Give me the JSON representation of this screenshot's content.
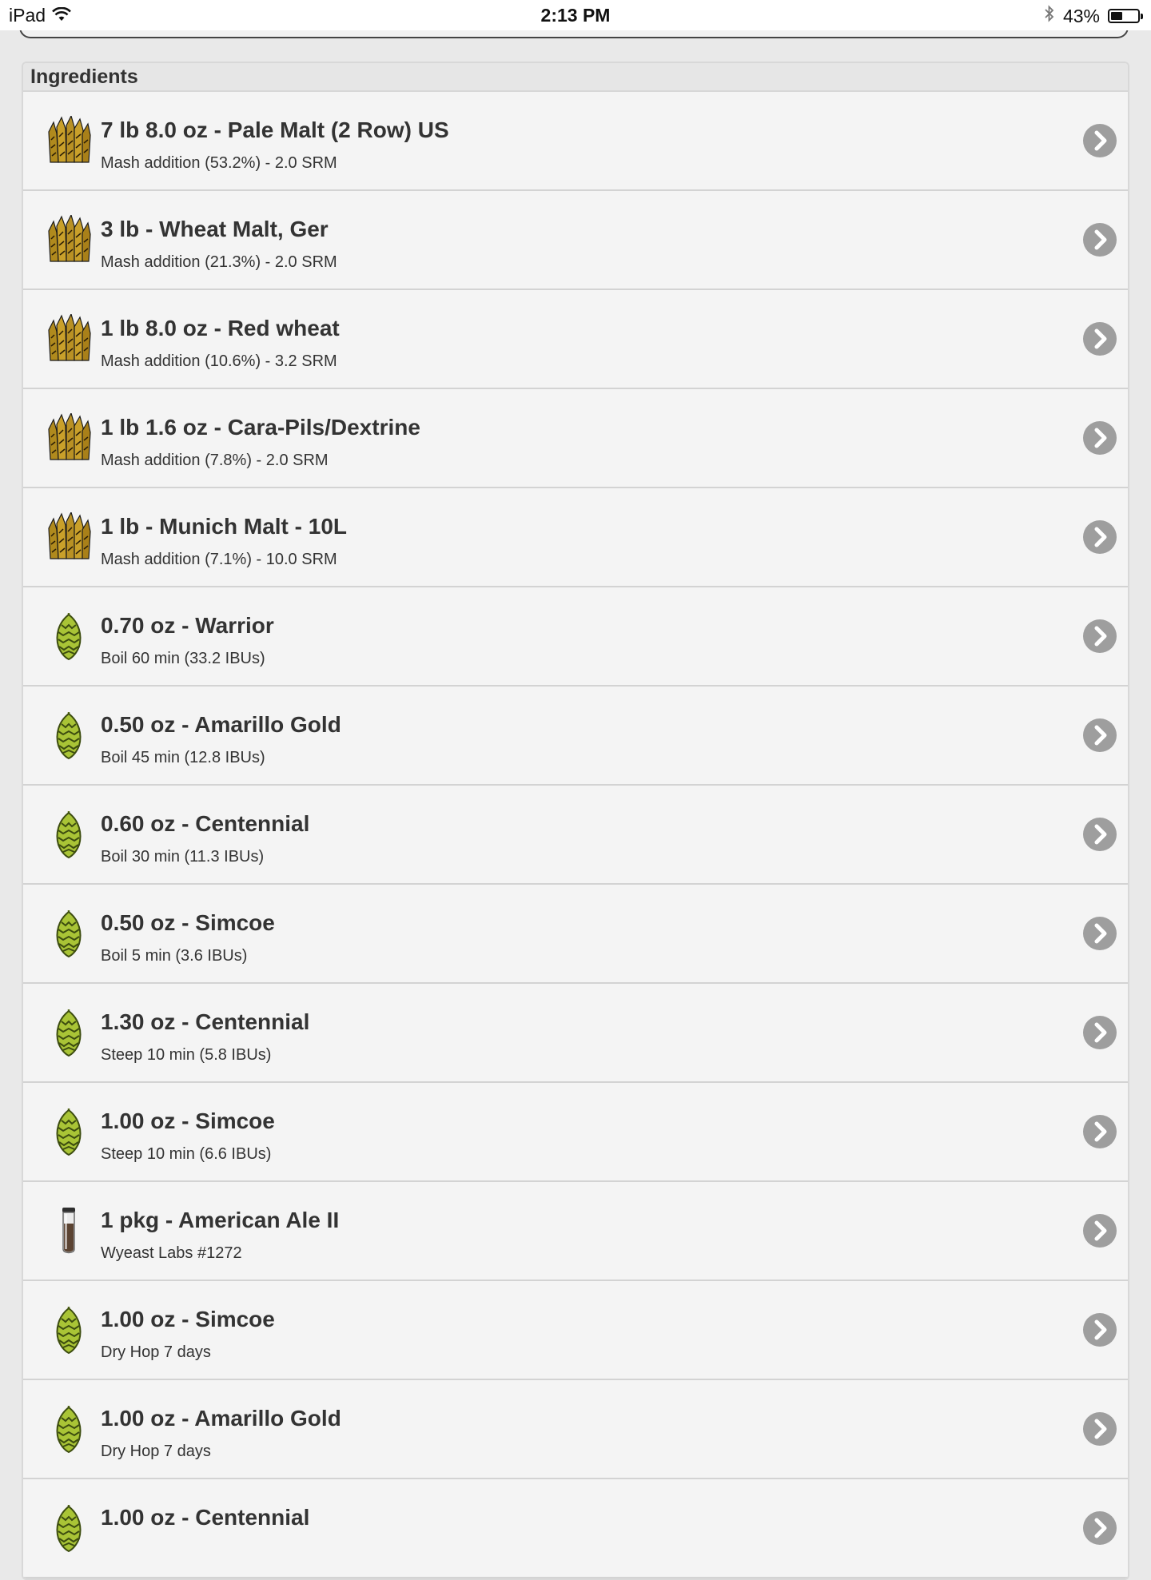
{
  "status_bar": {
    "device": "iPad",
    "time": "2:13 PM",
    "battery": "43%",
    "battery_level": 0.43,
    "icons": [
      "wifi-icon",
      "bluetooth-icon",
      "battery-icon"
    ]
  },
  "section": {
    "title": "Ingredients"
  },
  "ingredients": [
    {
      "type": "grain",
      "title": "7 lb 8.0 oz - Pale Malt (2 Row) US",
      "detail": "Mash addition (53.2%) - 2.0 SRM"
    },
    {
      "type": "grain",
      "title": "3 lb - Wheat Malt, Ger",
      "detail": "Mash addition (21.3%) - 2.0 SRM"
    },
    {
      "type": "grain",
      "title": "1 lb 8.0 oz - Red wheat",
      "detail": "Mash addition (10.6%) - 3.2 SRM"
    },
    {
      "type": "grain",
      "title": "1 lb 1.6 oz - Cara-Pils/Dextrine",
      "detail": "Mash addition (7.8%) - 2.0 SRM"
    },
    {
      "type": "grain",
      "title": "1 lb - Munich Malt - 10L",
      "detail": "Mash addition (7.1%) - 10.0 SRM"
    },
    {
      "type": "hop",
      "title": "0.70 oz - Warrior",
      "detail": "Boil 60 min (33.2 IBUs)"
    },
    {
      "type": "hop",
      "title": "0.50 oz - Amarillo Gold",
      "detail": "Boil 45 min (12.8 IBUs)"
    },
    {
      "type": "hop",
      "title": "0.60 oz - Centennial",
      "detail": "Boil 30 min (11.3 IBUs)"
    },
    {
      "type": "hop",
      "title": "0.50 oz - Simcoe",
      "detail": "Boil 5 min (3.6 IBUs)"
    },
    {
      "type": "hop",
      "title": "1.30 oz - Centennial",
      "detail": "Steep 10 min (5.8 IBUs)"
    },
    {
      "type": "hop",
      "title": "1.00 oz - Simcoe",
      "detail": "Steep 10 min (6.6 IBUs)"
    },
    {
      "type": "yeast",
      "title": "1 pkg - American Ale II",
      "detail": "Wyeast Labs #1272"
    },
    {
      "type": "hop",
      "title": "1.00 oz - Simcoe",
      "detail": "Dry Hop 7 days"
    },
    {
      "type": "hop",
      "title": "1.00 oz - Amarillo Gold",
      "detail": "Dry Hop 7 days"
    },
    {
      "type": "hop",
      "title": "1.00 oz - Centennial",
      "detail": ""
    }
  ],
  "icons": {
    "grain": "wheat-icon",
    "hop": "hop-icon",
    "yeast": "yeast-vial-icon",
    "chevron": "chevron-right-icon"
  }
}
